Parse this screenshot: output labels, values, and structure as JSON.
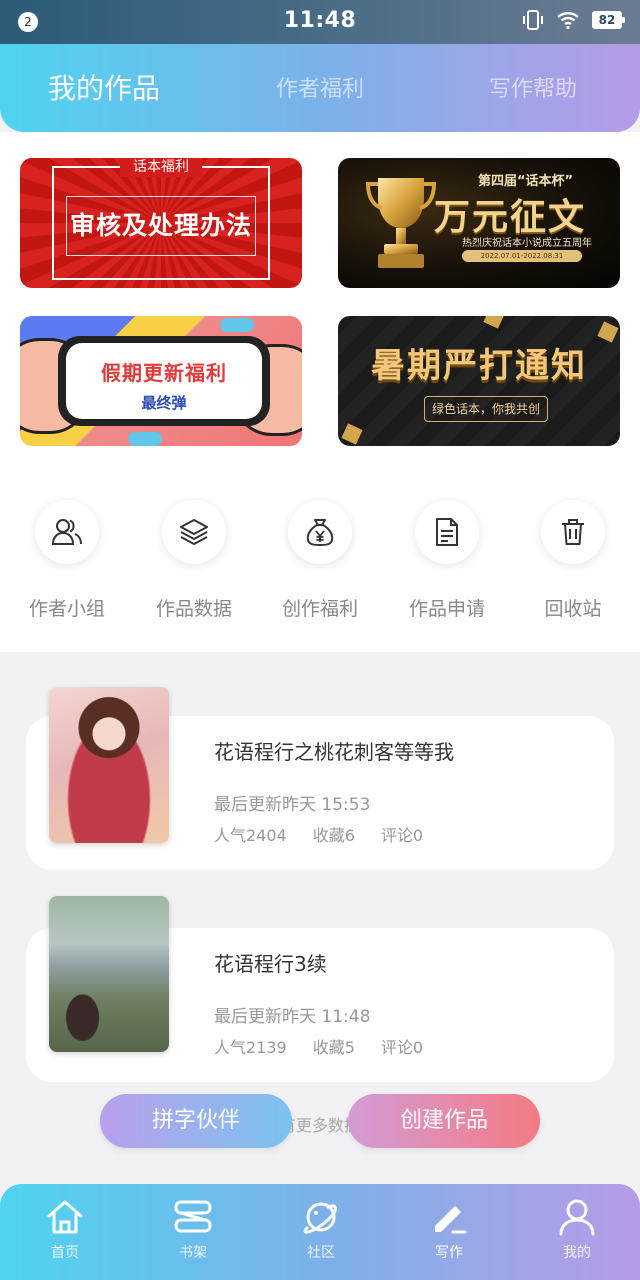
{
  "status_bar": {
    "notification_count": "2",
    "time": "11:48",
    "battery": "82"
  },
  "header": {
    "tabs": [
      {
        "label": "我的作品",
        "active": true
      },
      {
        "label": "作者福利",
        "active": false
      },
      {
        "label": "写作帮助",
        "active": false
      }
    ]
  },
  "banners": [
    {
      "kicker": "话本福利",
      "title": "审核及处理办法"
    },
    {
      "kicker": "第四届“话本杯”",
      "title": "万元征文",
      "subtitle": "热烈庆祝话本小说成立五周年",
      "date": "2022.07.01-2022.08.31"
    },
    {
      "title": "假期更新福利",
      "subtitle": "最终弹"
    },
    {
      "title": "暑期严打通知",
      "subtitle": "绿色话本，你我共创"
    }
  ],
  "quick_actions": [
    {
      "label": "作者小组",
      "icon": "people-icon"
    },
    {
      "label": "作品数据",
      "icon": "layers-icon"
    },
    {
      "label": "创作福利",
      "icon": "money-bag-icon"
    },
    {
      "label": "作品申请",
      "icon": "document-icon"
    },
    {
      "label": "回收站",
      "icon": "trash-icon"
    }
  ],
  "works": [
    {
      "title": "花语程行之桃花刺客等等我",
      "updated": "最后更新昨天 15:53",
      "popularity": "人气2404",
      "favorites": "收藏6",
      "comments": "评论0"
    },
    {
      "title": "花语程行3续",
      "updated": "最后更新昨天 11:48",
      "popularity": "人气2139",
      "favorites": "收藏5",
      "comments": "评论0"
    }
  ],
  "footer_note": "没有更多数据了",
  "buttons": {
    "partner": "拼字伙伴",
    "create": "创建作品"
  },
  "bottom_nav": [
    {
      "label": "首页",
      "icon": "home-icon"
    },
    {
      "label": "书架",
      "icon": "bookshelf-icon"
    },
    {
      "label": "社区",
      "icon": "planet-icon"
    },
    {
      "label": "写作",
      "icon": "pen-icon",
      "active": true
    },
    {
      "label": "我的",
      "icon": "user-icon"
    }
  ],
  "colors": {
    "gradient_start": "#4fd3f0",
    "gradient_end": "#b69ce6",
    "create_button_end": "#f37b83"
  }
}
